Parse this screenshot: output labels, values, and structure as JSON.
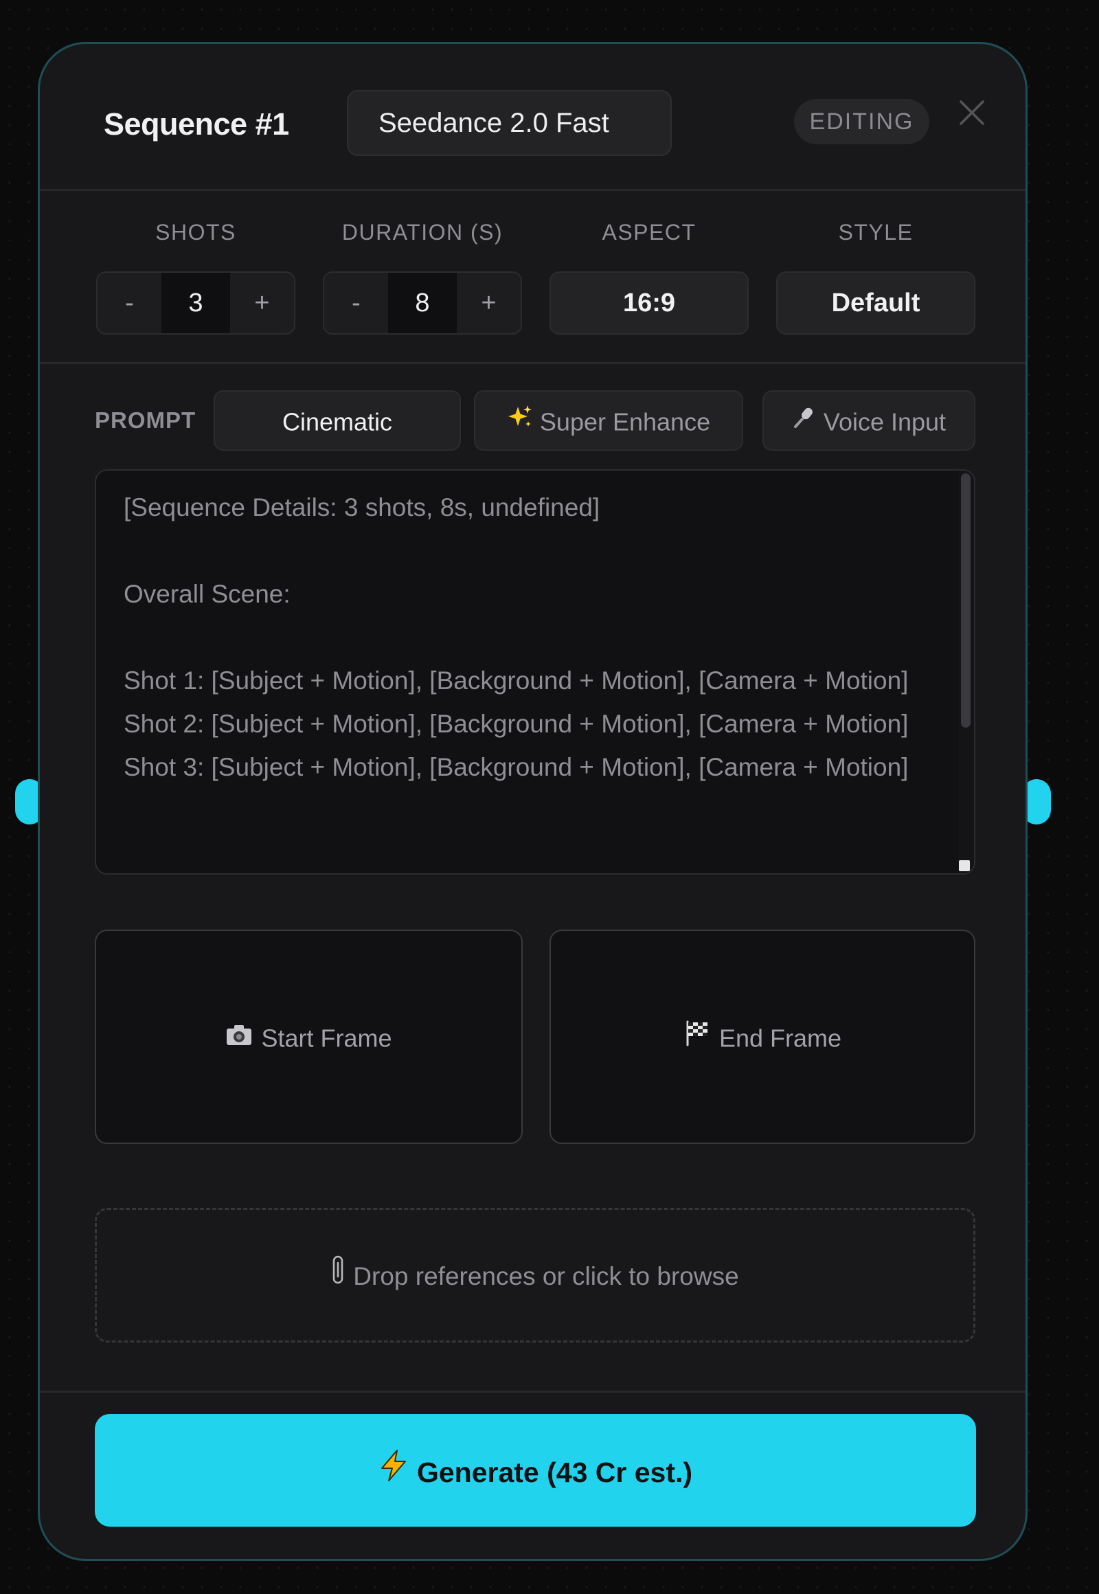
{
  "header": {
    "title": "Sequence #1",
    "model": "Seedance 2.0 Fast",
    "status_badge": "EDITING"
  },
  "params": {
    "shots": {
      "label": "SHOTS",
      "value": "3",
      "minus": "-",
      "plus": "+"
    },
    "duration": {
      "label": "DURATION (S)",
      "value": "8",
      "minus": "-",
      "plus": "+"
    },
    "aspect": {
      "label": "ASPECT",
      "value": "16:9"
    },
    "style": {
      "label": "STYLE",
      "value": "Default"
    }
  },
  "prompt": {
    "label": "PROMPT",
    "preset": "Cinematic",
    "super_enhance": "Super Enhance",
    "voice_input": "Voice Input",
    "text": "[Sequence Details: 3 shots, 8s, undefined]\n\nOverall Scene:\n\nShot 1: [Subject + Motion], [Background + Motion], [Camera + Motion]\nShot 2: [Subject + Motion], [Background + Motion], [Camera + Motion]\nShot 3: [Subject + Motion], [Background + Motion], [Camera + Motion]"
  },
  "frames": {
    "start": "Start Frame",
    "end": "End Frame"
  },
  "references": {
    "drop_text": "Drop references or click to browse"
  },
  "generate": {
    "label": "Generate (43 Cr est.)"
  },
  "colors": {
    "accent": "#22d3ee",
    "card_background": "#18181a",
    "page_background": "#0b0b0c",
    "card_border": "#1f4e57"
  },
  "icons": {
    "super_enhance": "sparkles-icon",
    "voice_input": "microphone-icon",
    "start_frame": "camera-icon",
    "end_frame": "checkered-flag-icon",
    "drop_zone": "paperclip-icon",
    "generate": "lightning-icon",
    "close": "close-icon"
  }
}
